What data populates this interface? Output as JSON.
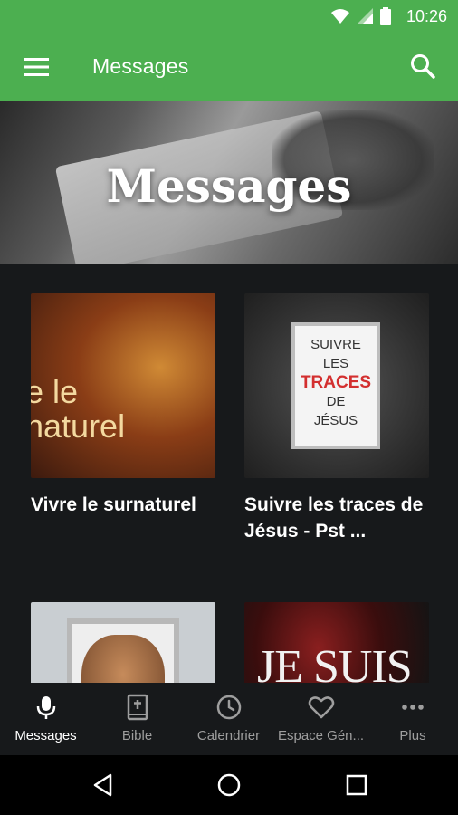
{
  "status_bar": {
    "time": "10:26",
    "icons": [
      "wifi-icon",
      "signal-icon",
      "battery-icon"
    ]
  },
  "app_bar": {
    "title": "Messages",
    "menu_icon": "menu-icon",
    "search_icon": "search-icon",
    "color": "#4caf50"
  },
  "hero": {
    "title": "Messages"
  },
  "cards": [
    {
      "title": "Vivre le surnaturel",
      "thumb_text": "e le\nnaturel"
    },
    {
      "title": "Suivre les traces de Jésus - Pst ...",
      "thumb_lines": [
        "SUIVRE",
        "LES",
        "TRACES",
        "DE",
        "JÉSUS"
      ]
    },
    {
      "title": ""
    },
    {
      "title": "",
      "thumb_text": "JE SUIS"
    }
  ],
  "bottom_nav": {
    "items": [
      {
        "label": "Messages",
        "icon": "microphone-icon",
        "active": true
      },
      {
        "label": "Bible",
        "icon": "bible-icon",
        "active": false
      },
      {
        "label": "Calendrier",
        "icon": "clock-icon",
        "active": false
      },
      {
        "label": "Espace Gén...",
        "icon": "heart-icon",
        "active": false
      },
      {
        "label": "Plus",
        "icon": "more-icon",
        "active": false
      }
    ]
  },
  "system_nav": {
    "icons": [
      "back-icon",
      "home-icon",
      "recents-icon"
    ]
  }
}
